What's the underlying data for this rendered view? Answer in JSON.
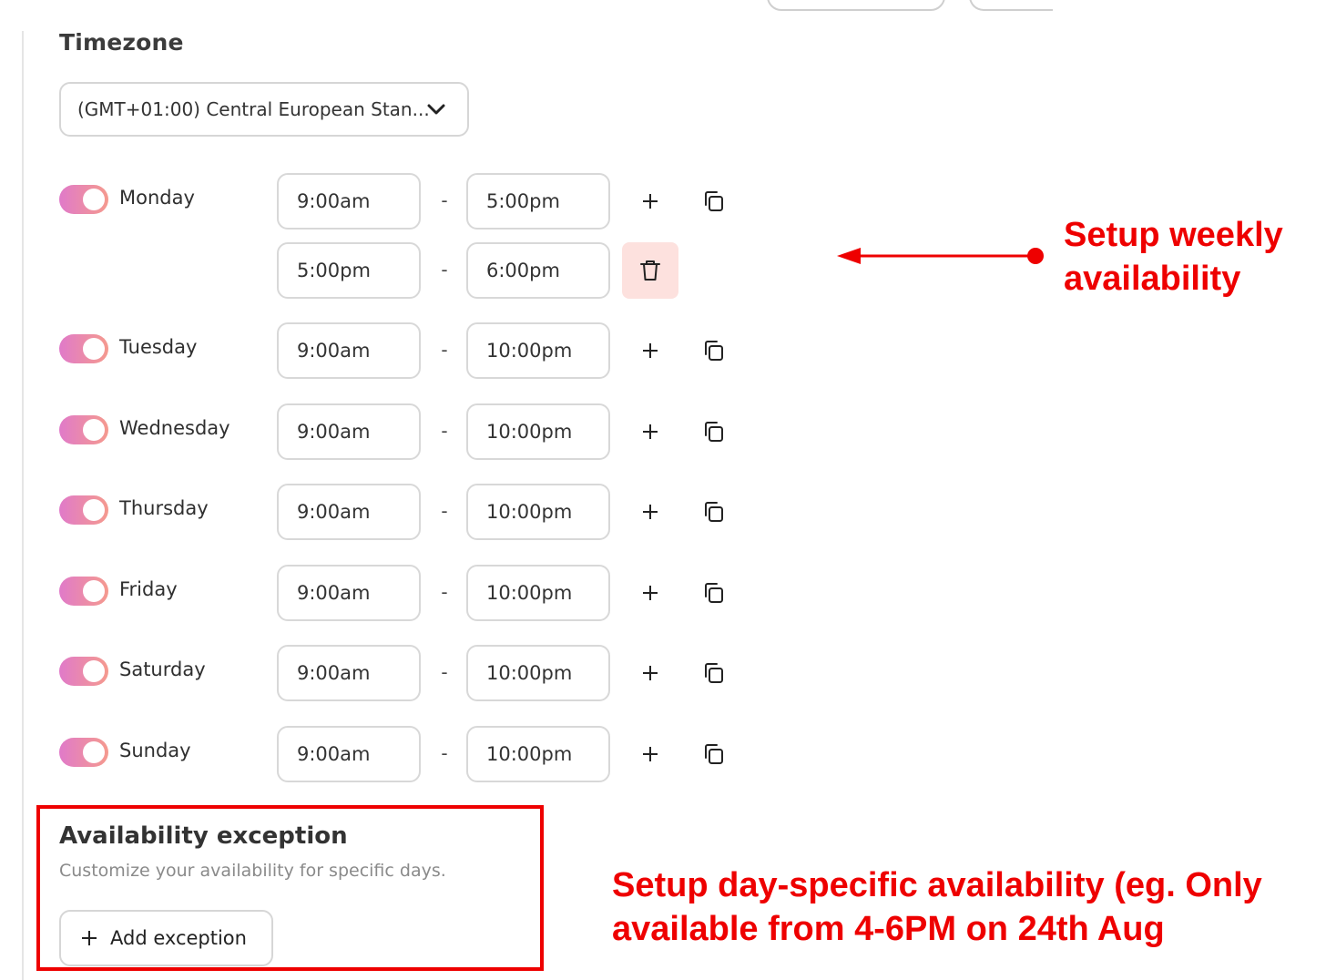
{
  "timezone": {
    "heading": "Timezone",
    "selected": "(GMT+01:00) Central European Stan...",
    "icon": "chevron-down-icon"
  },
  "days": [
    {
      "name": "Monday",
      "enabled": true,
      "slots": [
        {
          "start": "9:00am",
          "end": "5:00pm"
        },
        {
          "start": "5:00pm",
          "end": "6:00pm"
        }
      ]
    },
    {
      "name": "Tuesday",
      "enabled": true,
      "slots": [
        {
          "start": "9:00am",
          "end": "10:00pm"
        }
      ]
    },
    {
      "name": "Wednesday",
      "enabled": true,
      "slots": [
        {
          "start": "9:00am",
          "end": "10:00pm"
        }
      ]
    },
    {
      "name": "Thursday",
      "enabled": true,
      "slots": [
        {
          "start": "9:00am",
          "end": "10:00pm"
        }
      ]
    },
    {
      "name": "Friday",
      "enabled": true,
      "slots": [
        {
          "start": "9:00am",
          "end": "10:00pm"
        }
      ]
    },
    {
      "name": "Saturday",
      "enabled": true,
      "slots": [
        {
          "start": "9:00am",
          "end": "10:00pm"
        }
      ]
    },
    {
      "name": "Sunday",
      "enabled": true,
      "slots": [
        {
          "start": "9:00am",
          "end": "10:00pm"
        }
      ]
    }
  ],
  "separator": "-",
  "exception": {
    "title": "Availability exception",
    "subtitle": "Customize your availability for specific days.",
    "add_label": "Add exception"
  },
  "annotations": {
    "weekly_line1": "Setup weekly",
    "weekly_line2": "availability",
    "specific_line1": "Setup day-specific availability (eg. Only",
    "specific_line2": "available from 4-6PM on 24th Aug"
  },
  "colors": {
    "toggle_gradient_start": "#e07ac9",
    "toggle_gradient_end": "#f59a8e",
    "annotation_red": "#ee0000",
    "trash_bg": "#fde1de"
  }
}
